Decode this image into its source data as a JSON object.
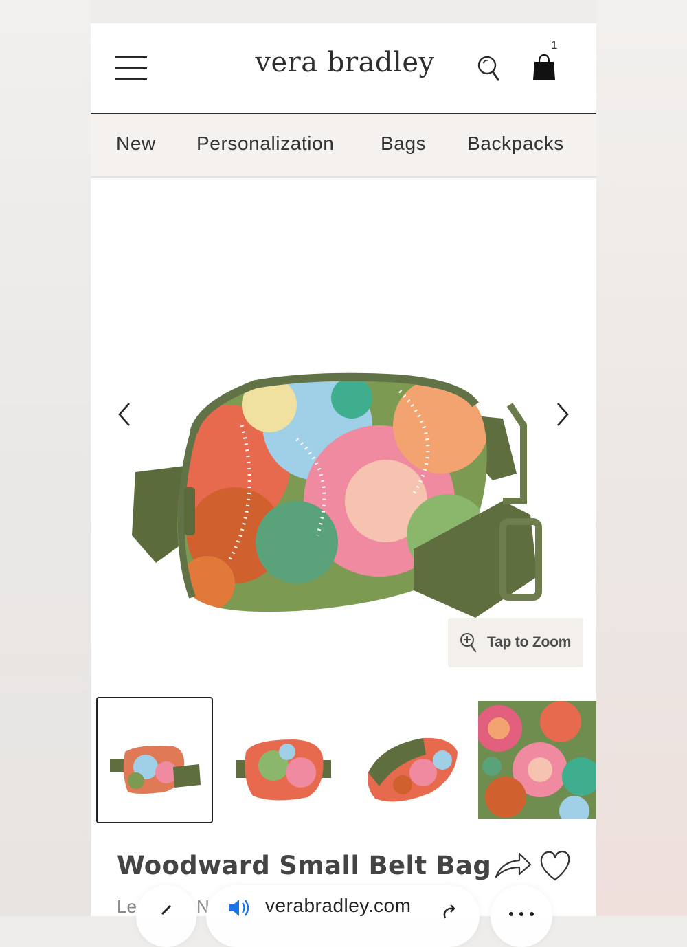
{
  "header": {
    "logo": "vera bradley",
    "cart_count": "1"
  },
  "nav": {
    "items": [
      "New",
      "Personalization",
      "Bags",
      "Backpacks"
    ]
  },
  "gallery": {
    "zoom_label": "Tap to Zoom",
    "thumbnail_count": 4,
    "active_thumbnail": 1
  },
  "product": {
    "title": "Woodward Small Belt Bag",
    "sub_left": "Le",
    "sub_right": "N"
  },
  "browser": {
    "url": "verabradley.com"
  },
  "colors": {
    "accent": "#2b2b2b",
    "nav_bg": "#f4f1ee",
    "strap_green": "#5e6e3e"
  }
}
